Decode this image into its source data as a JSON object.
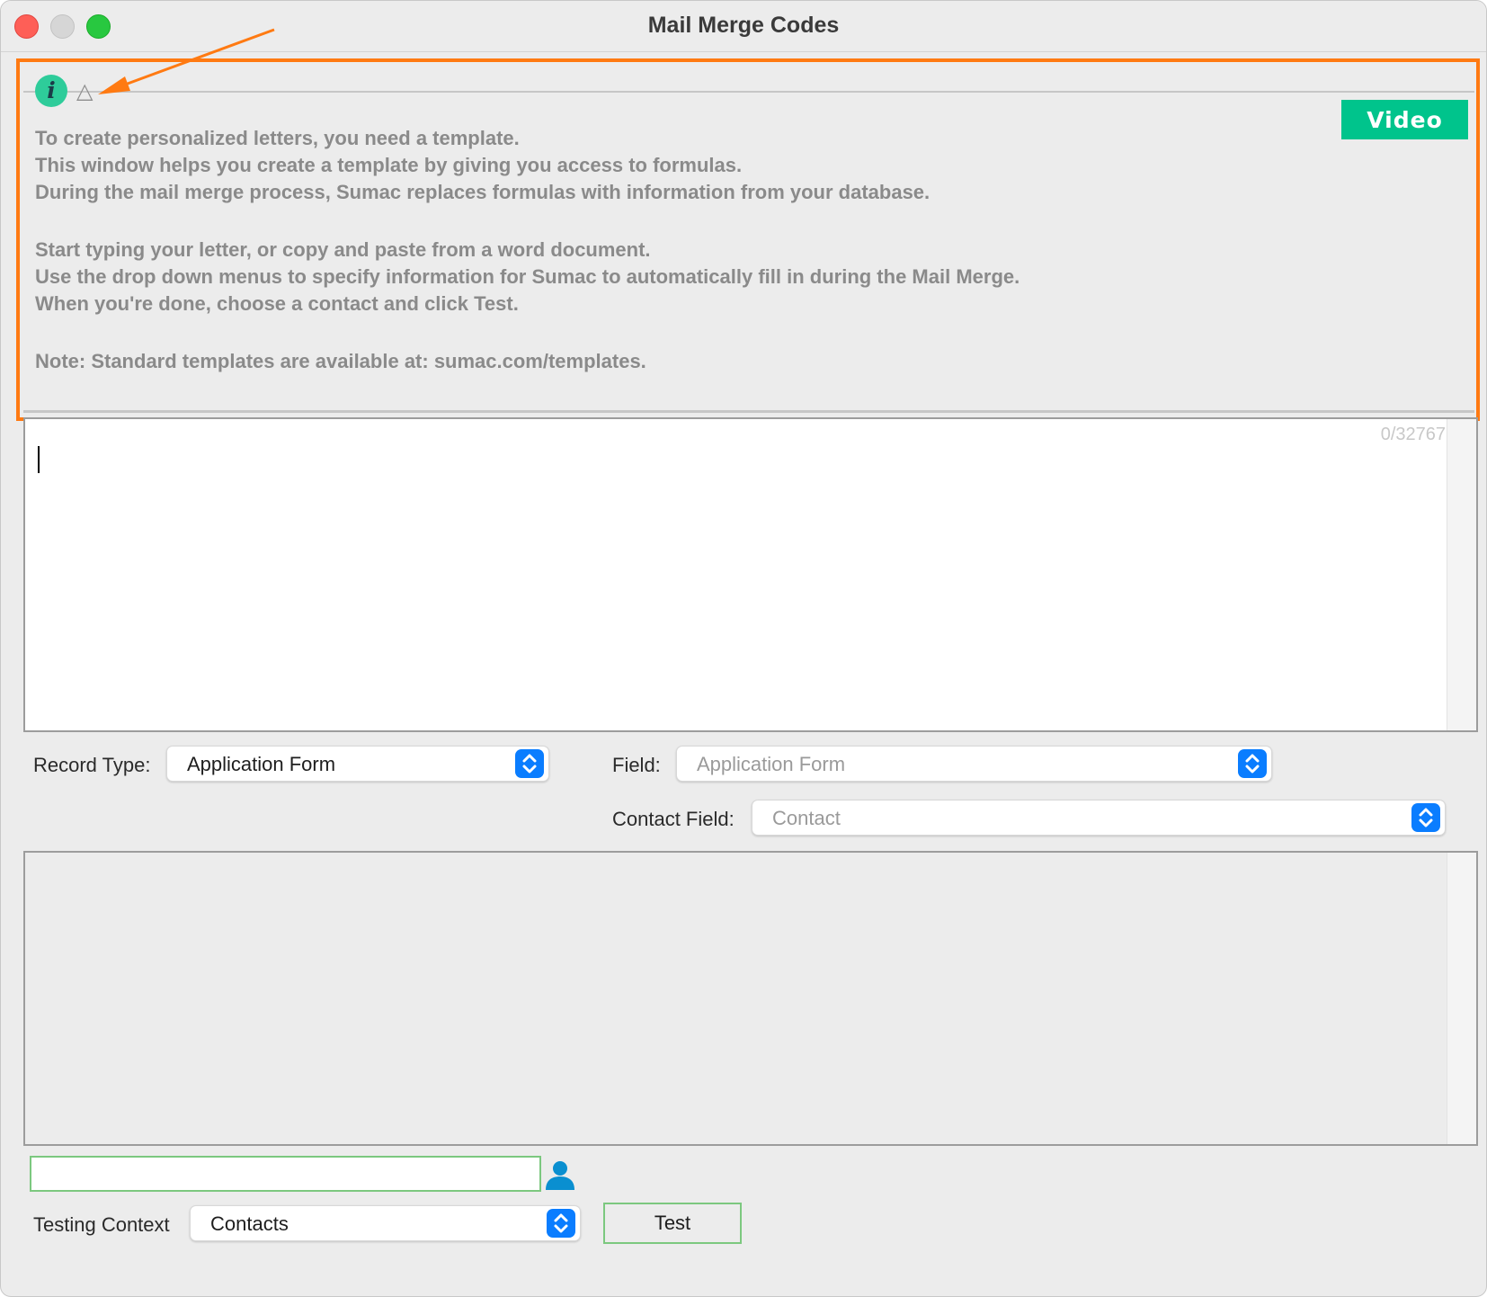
{
  "window": {
    "title": "Mail Merge Codes"
  },
  "info": {
    "video_label": "Video",
    "lines": [
      "To create personalized letters, you need a template.",
      "This window helps you create a template by giving you access to formulas.",
      "During the mail merge process, Sumac replaces formulas with information from your database.",
      "Start typing your letter, or copy and paste from a word document.",
      "Use the drop down menus to specify information for Sumac to automatically fill in during the Mail Merge.",
      "When you're done, choose a contact and click Test.",
      "Note: Standard templates are available at: sumac.com/templates."
    ]
  },
  "editor": {
    "char_count": "0/32767",
    "content": ""
  },
  "record_type": {
    "label": "Record Type:",
    "value": "Application Form"
  },
  "field": {
    "label": "Field:",
    "placeholder": "Application Form"
  },
  "contact_field": {
    "label": "Contact Field:",
    "placeholder": "Contact"
  },
  "preview": {
    "content": ""
  },
  "contact_search": {
    "value": ""
  },
  "testing_context": {
    "label": "Testing Context",
    "value": "Contacts"
  },
  "test_button": {
    "label": "Test"
  },
  "colors": {
    "annotation": "#ff7a12",
    "video_button": "#00c48c",
    "info_icon": "#2ecc9a",
    "stepper": "#0a7dff",
    "contact_border": "#7cc87f",
    "person_icon": "#0a8fd0"
  },
  "icons": [
    "info-icon",
    "warning-triangle-icon",
    "person-icon",
    "chevron-up-down-icon"
  ]
}
